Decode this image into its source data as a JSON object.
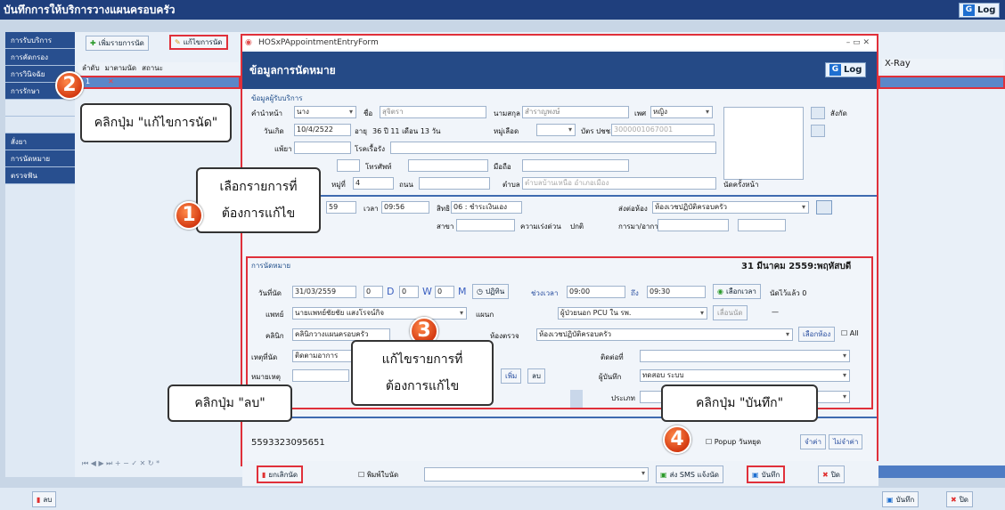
{
  "window": {
    "title": "บันทึกการให้บริการวางแผนครอบครัว",
    "log": "Log"
  },
  "nav": {
    "items": [
      "การรับบริการ",
      "การคัดกรอง",
      "การวินิจฉัย",
      "การรักษา",
      "",
      "",
      "สั่งยา",
      "การนัดหมาย",
      "ตรวจฟัน"
    ]
  },
  "toolbar": {
    "add": "เพิ่มรายการนัด",
    "edit": "แก้ไขการนัด"
  },
  "grid": {
    "columns": [
      "ลำดับ",
      "มาตามนัด",
      "สถานะ"
    ],
    "row": [
      "1",
      "✕",
      ""
    ],
    "xray": "X-Ray"
  },
  "dialog": {
    "title": "HOSxPAppointmentEntryForm",
    "header": "ข้อมูลการนัดหมาย",
    "log": "Log",
    "patient_section": "ข้อมูลผู้รับบริการ",
    "prefix_lbl": "คำนำหน้า",
    "prefix": "นาง",
    "name_lbl": "ชื่อ",
    "name": "สุจิตรา",
    "surname_lbl": "นามสกุล",
    "surname": "สำราญพงษ์",
    "sex_lbl": "เพศ",
    "sex": "หญิง",
    "affil": "สังกัด",
    "birth_lbl": "วันเกิด",
    "birth": "10/4/2522",
    "age_lbl": "อายุ",
    "age": "36 ปี 11 เดือน 13 วัน",
    "blood_lbl": "หมู่เลือด",
    "idcard_lbl": "บัตร ปชช.",
    "idcard": "3000001067001",
    "allergy_lbl": "แพ้ยา",
    "chronic_lbl": "โรคเรื้อรัง",
    "phone_lbl": "โทรศัพท์",
    "mobile_lbl": "มือถือ",
    "moo_lbl": "หมู่ที่",
    "moo": "4",
    "road_lbl": "ถนน",
    "tambon_lbl": "ตำบล",
    "tambon": "ตำบลบ้านเหนือ อำเภอเมือง",
    "lastvisit": "นัดครั้งหน้า",
    "visitdate": "59",
    "time_lbl": "เวลา",
    "time": "09:56",
    "right_lbl": "สิทธิ",
    "right": "06 : ชำระเงินเอง",
    "sendto_lbl": "ส่งต่อห้อง",
    "sendto": "ห้องเวชปฏิบัติครอบครัว",
    "branch_lbl": "สาขา",
    "urgency_lbl": "ความเร่งด่วน",
    "urgency": "ปกติ",
    "symptom_lbl": "การมา/อาการ",
    "appt_section": "การนัดหมาย",
    "appt_date_head": "31 มีนาคม 2559:พฤหัสบดี",
    "appt_date_lbl": "วันที่นัด",
    "appt_date": "31/03/2559",
    "d": "D",
    "w": "W",
    "m": "M",
    "zero": "0",
    "calendar": "ปฏิทิน",
    "period_lbl": "ช่วงเวลา",
    "from": "09:00",
    "to_lbl": "ถึง",
    "to": "09:30",
    "picktime": "เลือกเวลา",
    "booked": "นัดไว้แล้ว 0",
    "doctor_lbl": "แพทย์",
    "doctor": "นายแพทย์ชัยชัย แสงโรจน์กิจ",
    "dept_lbl": "แผนก",
    "dept": "ผู้ป่วยนอก PCU ใน รพ.",
    "movebtn": "เลื่อนนัด",
    "dash": "—",
    "clinic_lbl": "คลินิก",
    "clinic": "คลินิกวางแผนครอบครัว",
    "room_lbl": "ห้องตรวจ",
    "room": "ห้องเวชปฏิบัติครอบครัว",
    "roombtn": "เลือกห้อง",
    "all": "All",
    "cause_lbl": "เหตุที่นัด",
    "cause": "ติดตามอาการ",
    "contact_lbl": "ติดต่อที่",
    "note_lbl": "หมายเหตุ",
    "addbtn": "เพิ่ม",
    "delbtn": "ลบ",
    "recorder_lbl": "ผู้บันทึก",
    "recorder": "ทดสอบ ระบบ",
    "type_lbl": "ประเภท",
    "hn": "5593323095651",
    "popup": "Popup วันหยุด",
    "remember": "จำค่า",
    "forget": "ไม่จำค่า",
    "cancel": "ยกเลิกนัด",
    "print": "พิมพ์ใบนัด",
    "sms": "ส่ง SMS แจ้งนัด",
    "save": "บันทึก",
    "close": "ปิด"
  },
  "bottom": {
    "delete": "ลบ",
    "save": "บันทึก",
    "close": "ปิด"
  },
  "callouts": {
    "c1": "เลือกรายการที่\nต้องการแก้ไข",
    "c2": "คลิกปุ่ม \"แก้ไขการนัด\"",
    "c3": "แก้ไขรายการที่\nต้องการแก้ไข",
    "c4": "คลิกปุ่ม \"บันทึก\"",
    "c5": "คลิกปุ่ม \"ลบ\"",
    "n1": "1",
    "n2": "2",
    "n3": "3",
    "n4": "4"
  }
}
